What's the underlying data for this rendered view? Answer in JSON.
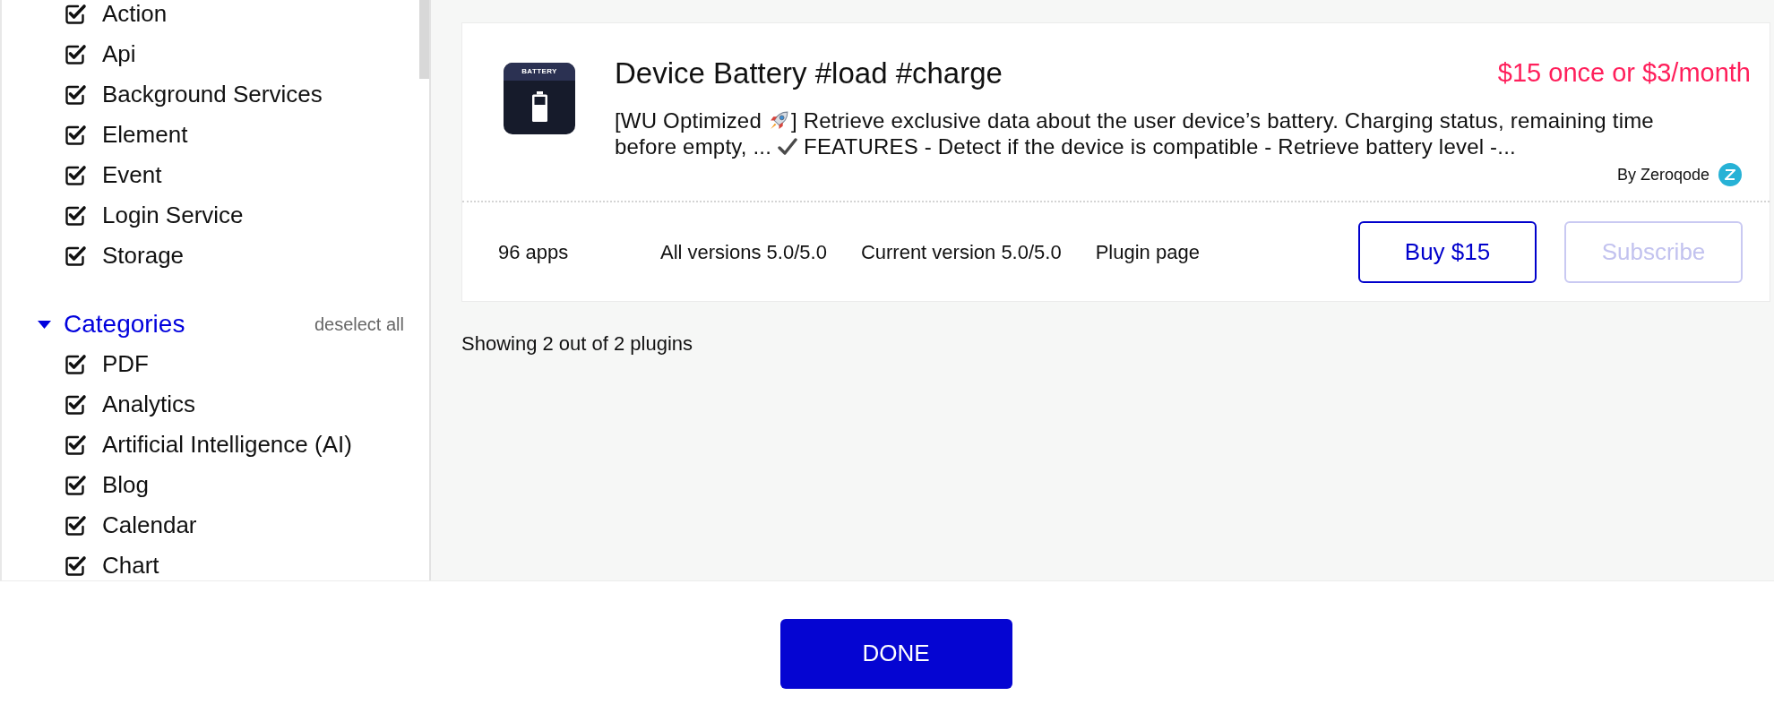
{
  "sidebar": {
    "groups": [
      {
        "items": [
          {
            "label": "Action",
            "checked": true
          },
          {
            "label": "Api",
            "checked": true
          },
          {
            "label": "Background Services",
            "checked": true
          },
          {
            "label": "Element",
            "checked": true
          },
          {
            "label": "Event",
            "checked": true
          },
          {
            "label": "Login Service",
            "checked": true
          },
          {
            "label": "Storage",
            "checked": true
          }
        ]
      },
      {
        "title": "Categories",
        "expanded": true,
        "action": "deselect all",
        "items": [
          {
            "label": "PDF",
            "checked": true
          },
          {
            "label": "Analytics",
            "checked": true
          },
          {
            "label": "Artificial Intelligence (AI)",
            "checked": true
          },
          {
            "label": "Blog",
            "checked": true
          },
          {
            "label": "Calendar",
            "checked": true
          },
          {
            "label": "Chart",
            "checked": true
          }
        ]
      }
    ]
  },
  "plugins": [
    {
      "icon_caption": "BATTERY",
      "title": "Device Battery #load #charge",
      "price": "$15 once or $3/month",
      "description_lines": [
        [
          {
            "kind": "text",
            "text": "[WU Optimized"
          },
          {
            "kind": "rocket"
          },
          {
            "kind": "text",
            "text": "] Retrieve exclusive data about the user device’s battery. Charging status, remaining time"
          }
        ],
        [
          {
            "kind": "text",
            "text": "before empty, ..."
          },
          {
            "kind": "check"
          },
          {
            "kind": "text",
            "text": "FEATURES - Detect if the device is compatible - Retrieve battery level -..."
          }
        ]
      ],
      "author": "By Zeroqode",
      "stats": [
        "96 apps",
        "All versions 5.0/5.0",
        "Current version 5.0/5.0"
      ],
      "link": "Plugin page",
      "buttons": [
        {
          "label": "Buy $15",
          "disabled": false
        },
        {
          "label": "Subscribe",
          "disabled": true
        }
      ]
    }
  ],
  "results_summary": "Showing 2 out of 2 plugins",
  "footer": {
    "button": "DONE"
  }
}
